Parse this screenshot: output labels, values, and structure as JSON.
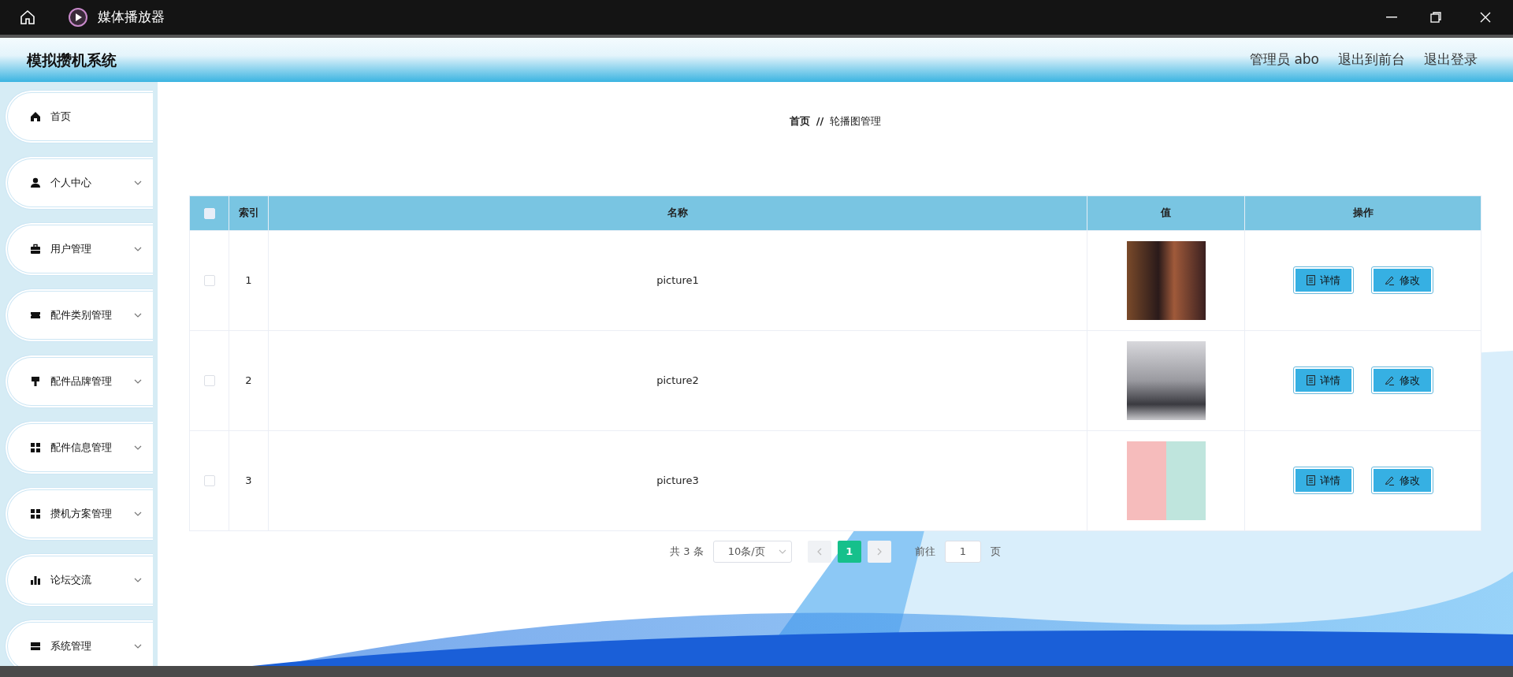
{
  "window": {
    "title": "媒体播放器"
  },
  "header": {
    "title": "模拟攒机系统",
    "links": [
      "管理员 abo",
      "退出到前台",
      "退出登录"
    ]
  },
  "sidebar": {
    "items": [
      {
        "label": "首页",
        "expandable": false
      },
      {
        "label": "个人中心",
        "expandable": true
      },
      {
        "label": "用户管理",
        "expandable": true
      },
      {
        "label": "配件类别管理",
        "expandable": true
      },
      {
        "label": "配件品牌管理",
        "expandable": true
      },
      {
        "label": "配件信息管理",
        "expandable": true
      },
      {
        "label": "攒机方案管理",
        "expandable": true
      },
      {
        "label": "论坛交流",
        "expandable": true
      },
      {
        "label": "系统管理",
        "expandable": true
      }
    ]
  },
  "breadcrumb": {
    "items": [
      "首页",
      "轮播图管理"
    ],
    "separator": "//"
  },
  "table": {
    "select_all": {
      "checked": false
    },
    "columns": [
      "索引",
      "名称",
      "值",
      "操作"
    ],
    "rows": [
      {
        "checked": false,
        "index": "1",
        "name": "picture1",
        "actions": [
          "详情",
          "修改"
        ]
      },
      {
        "checked": false,
        "index": "2",
        "name": "picture2",
        "actions": [
          "详情",
          "修改"
        ]
      },
      {
        "checked": false,
        "index": "3",
        "name": "picture3",
        "actions": [
          "详情",
          "修改"
        ]
      }
    ]
  },
  "pagination": {
    "total": "共 3 条",
    "page_size": "10条/页",
    "pages": [
      {
        "label": "1",
        "selected": true
      }
    ],
    "goto_label": "前往",
    "goto_value": "1",
    "goto_suffix": "页"
  }
}
